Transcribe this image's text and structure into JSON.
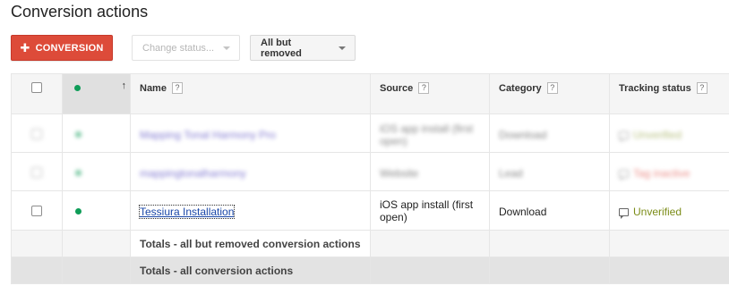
{
  "page": {
    "title": "Conversion actions"
  },
  "toolbar": {
    "add_label": "CONVERSION",
    "change_status_label": "Change status...",
    "filter_label": "All but removed"
  },
  "colors": {
    "primary_button": "#dd4b39",
    "enabled_dot": "#0f9d58",
    "unverified": "#7b8c17",
    "tag_inactive": "#d93025"
  },
  "table": {
    "headers": {
      "name": "Name",
      "source": "Source",
      "category": "Category",
      "tracking": "Tracking status"
    },
    "help_glyph": "?",
    "sort_glyph": "↑",
    "rows": [
      {
        "name": "Mapping Tonal Harmony Pro",
        "source": "iOS app install (first open)",
        "category": "Download",
        "tracking": "Unverified",
        "blurred": true
      },
      {
        "name": "mappingtonalharmony",
        "source": "Website",
        "category": "Lead",
        "tracking": "Tag inactive",
        "blurred": true
      },
      {
        "name": "Tessiura Installation",
        "source": "iOS app install (first open)",
        "category": "Download",
        "tracking": "Unverified",
        "blurred": false
      }
    ],
    "totals_filtered": "Totals - all but removed conversion actions",
    "totals_all": "Totals - all conversion actions"
  }
}
